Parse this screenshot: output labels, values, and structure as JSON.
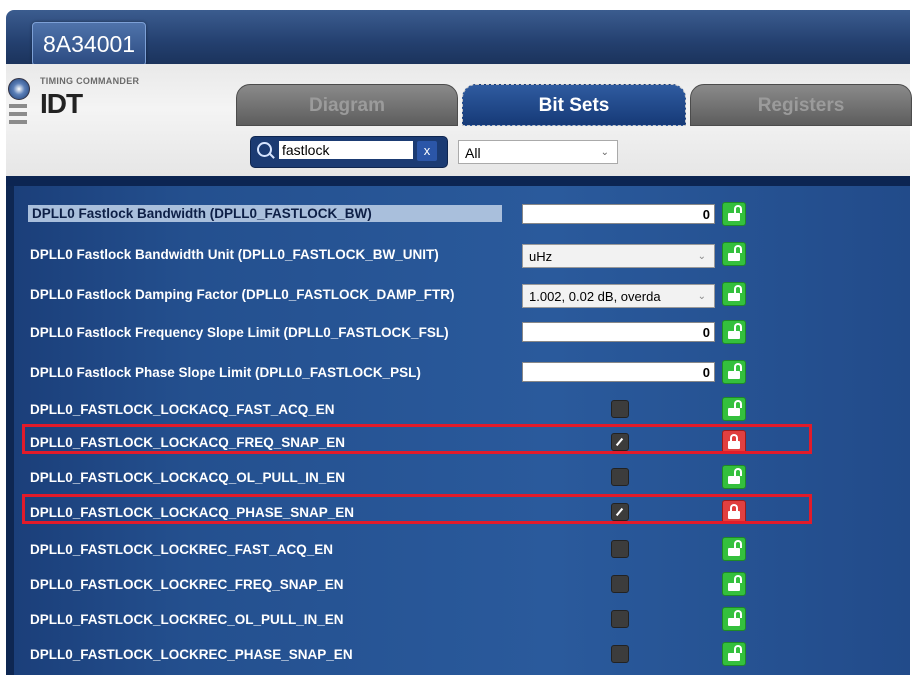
{
  "window": {
    "device_id": "8A34001"
  },
  "header": {
    "brand_small": "TIMING COMMANDER",
    "brand": "IDT",
    "tabs": [
      {
        "label": "Diagram",
        "active": false
      },
      {
        "label": "Bit Sets",
        "active": true
      },
      {
        "label": "Registers",
        "active": false
      }
    ],
    "search": {
      "value": "fastlock",
      "clear_label": "x"
    },
    "filter": {
      "value": "All"
    }
  },
  "rows": [
    {
      "label": "DPLL0 Fastlock Bandwidth (DPLL0_FASTLOCK_BW)",
      "control": "number",
      "value": "0",
      "locked": false,
      "selected": true
    },
    {
      "label": "DPLL0 Fastlock Bandwidth Unit (DPLL0_FASTLOCK_BW_UNIT)",
      "control": "dropdown",
      "value": "uHz",
      "locked": false
    },
    {
      "label": "DPLL0 Fastlock Damping Factor (DPLL0_FASTLOCK_DAMP_FTR)",
      "control": "dropdown",
      "value": "1.002, 0.02 dB, overda",
      "locked": false
    },
    {
      "label": "DPLL0 Fastlock Frequency Slope Limit (DPLL0_FASTLOCK_FSL)",
      "control": "number",
      "value": "0",
      "locked": false
    },
    {
      "label": "DPLL0 Fastlock Phase Slope Limit (DPLL0_FASTLOCK_PSL)",
      "control": "number",
      "value": "0",
      "locked": false
    },
    {
      "label": "DPLL0_FASTLOCK_LOCKACQ_FAST_ACQ_EN",
      "control": "checkbox",
      "checked": false,
      "locked": false
    },
    {
      "label": "DPLL0_FASTLOCK_LOCKACQ_FREQ_SNAP_EN",
      "control": "checkbox",
      "checked": true,
      "locked": true,
      "highlighted": true
    },
    {
      "label": "DPLL0_FASTLOCK_LOCKACQ_OL_PULL_IN_EN",
      "control": "checkbox",
      "checked": false,
      "locked": false
    },
    {
      "label": "DPLL0_FASTLOCK_LOCKACQ_PHASE_SNAP_EN",
      "control": "checkbox",
      "checked": true,
      "locked": true,
      "highlighted": true
    },
    {
      "label": "DPLL0_FASTLOCK_LOCKREC_FAST_ACQ_EN",
      "control": "checkbox",
      "checked": false,
      "locked": false
    },
    {
      "label": "DPLL0_FASTLOCK_LOCKREC_FREQ_SNAP_EN",
      "control": "checkbox",
      "checked": false,
      "locked": false
    },
    {
      "label": "DPLL0_FASTLOCK_LOCKREC_OL_PULL_IN_EN",
      "control": "checkbox",
      "checked": false,
      "locked": false
    },
    {
      "label": "DPLL0_FASTLOCK_LOCKREC_PHASE_SNAP_EN",
      "control": "checkbox",
      "checked": false,
      "locked": false
    }
  ],
  "colors": {
    "accent": "#1b3f7a",
    "highlight": "#e21b2a",
    "unlocked": "#34c03d",
    "locked": "#e04040"
  }
}
